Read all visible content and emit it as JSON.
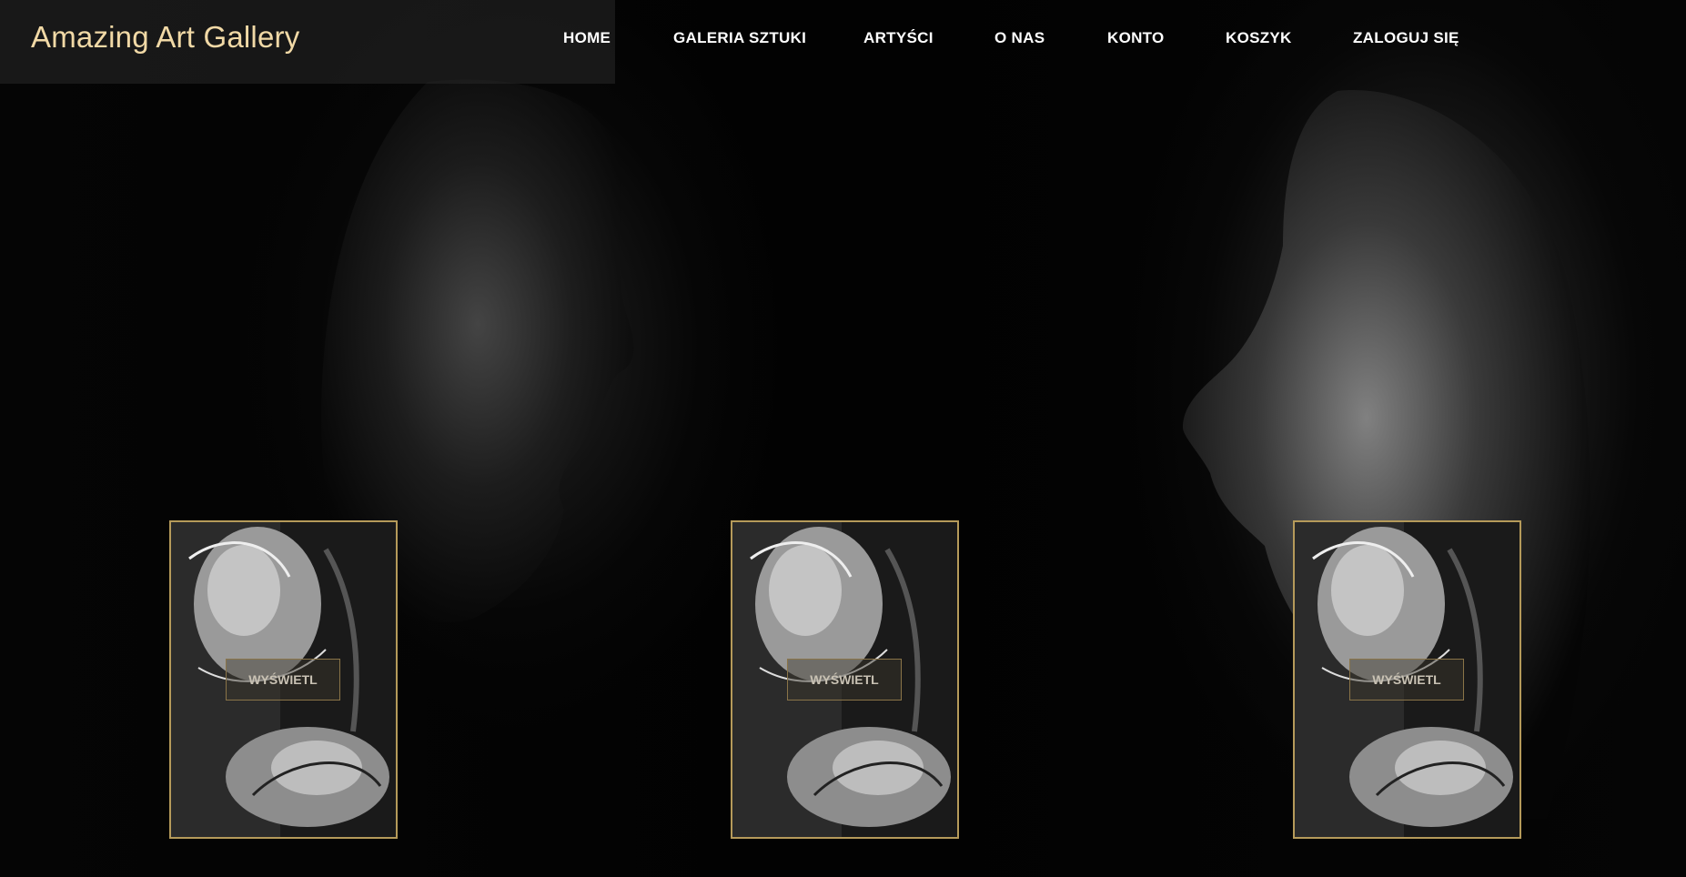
{
  "brand": {
    "title": "Amazing Art Gallery"
  },
  "nav": {
    "items": [
      {
        "label": "HOME"
      },
      {
        "label": "GALERIA SZTUKI"
      },
      {
        "label": "ARTYŚCI"
      },
      {
        "label": "O NAS"
      },
      {
        "label": "KONTO"
      },
      {
        "label": "KOSZYK"
      },
      {
        "label": "ZALOGUJ SIĘ"
      }
    ]
  },
  "gallery": {
    "cards": [
      {
        "button_label": "WYŚWIETL"
      },
      {
        "button_label": "WYŚWIETL"
      },
      {
        "button_label": "WYŚWIETL"
      }
    ]
  },
  "colors": {
    "brand": "#f1d9a6",
    "card_border": "#b59a5a",
    "background": "#000000",
    "nav_text": "#ffffff"
  }
}
